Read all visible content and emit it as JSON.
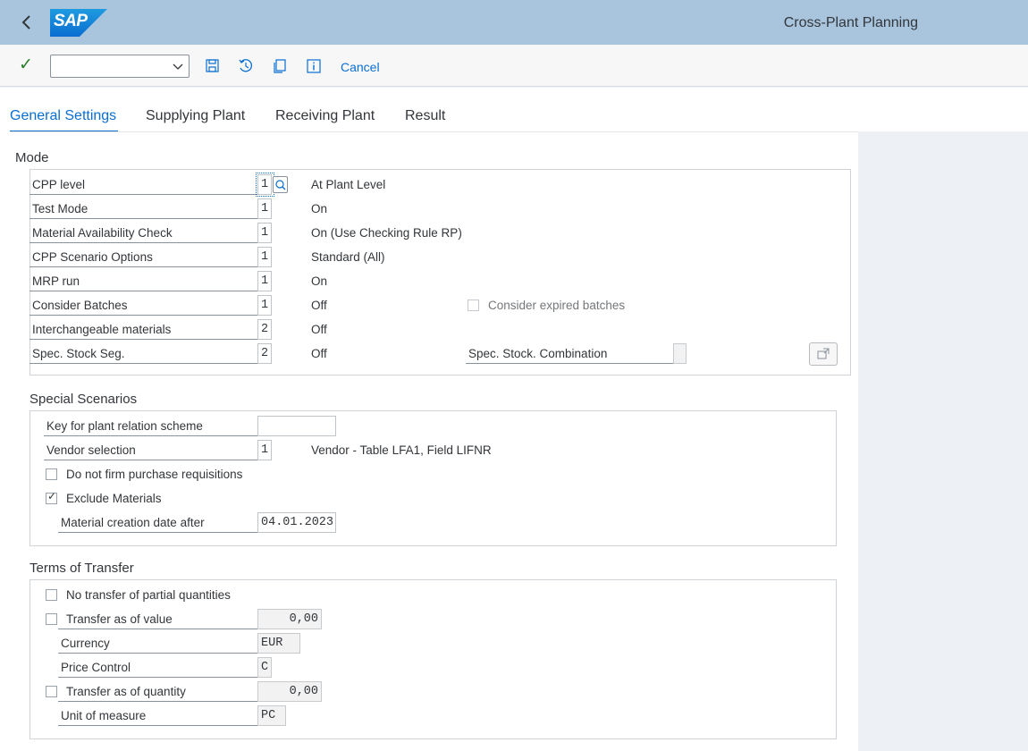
{
  "shell": {
    "logo_text": "SAP",
    "title": "Cross-Plant Planning"
  },
  "toolbar": {
    "select_value": "",
    "cancel_label": "Cancel",
    "icons": [
      "check-icon",
      "save-icon",
      "history-icon",
      "copy-icon",
      "info-icon"
    ]
  },
  "tabs": [
    {
      "label": "General Settings",
      "active": true
    },
    {
      "label": "Supplying Plant",
      "active": false
    },
    {
      "label": "Receiving Plant",
      "active": false
    },
    {
      "label": "Result",
      "active": false
    }
  ],
  "mode": {
    "title": "Mode",
    "rows": [
      {
        "label": "CPP level",
        "value": "1",
        "desc": "At Plant Level"
      },
      {
        "label": "Test Mode",
        "value": "1",
        "desc": "On"
      },
      {
        "label": "Material Availability Check",
        "value": "1",
        "desc": "On (Use Checking Rule RP)"
      },
      {
        "label": "CPP Scenario Options",
        "value": "1",
        "desc": "Standard (All)"
      },
      {
        "label": "MRP run",
        "value": "1",
        "desc": "On"
      },
      {
        "label": "Consider Batches",
        "value": "1",
        "desc": "Off"
      },
      {
        "label": "Interchangeable materials",
        "value": "2",
        "desc": "Off"
      },
      {
        "label": "Spec. Stock Seg.",
        "value": "2",
        "desc": "Off"
      }
    ],
    "consider_expired_batches": {
      "label": "Consider expired batches",
      "checked": false
    },
    "spec_stock_combination": {
      "label": "Spec. Stock. Combination",
      "value": ""
    }
  },
  "special": {
    "title": "Special Scenarios",
    "plant_relation": {
      "label": "Key for plant relation scheme",
      "value": ""
    },
    "vendor_selection": {
      "label": "Vendor selection",
      "value": "1",
      "desc": "Vendor - Table LFA1, Field LIFNR"
    },
    "no_firm": {
      "label": "Do not firm purchase requisitions",
      "checked": false
    },
    "exclude": {
      "label": "Exclude Materials",
      "checked": true
    },
    "creation_date": {
      "label": "Material creation date after",
      "value": "04.01.2023"
    }
  },
  "terms": {
    "title": "Terms of Transfer",
    "no_partial": {
      "label": "No transfer of partial quantities",
      "checked": false
    },
    "as_value": {
      "label": "Transfer as of value",
      "checked": false,
      "value": "0,00"
    },
    "currency": {
      "label": "Currency",
      "value": "EUR"
    },
    "price_control": {
      "label": "Price Control",
      "value": "C"
    },
    "as_quantity": {
      "label": "Transfer as of quantity",
      "checked": false,
      "value": "0,00"
    },
    "uom": {
      "label": "Unit of measure",
      "value": "PC"
    }
  }
}
